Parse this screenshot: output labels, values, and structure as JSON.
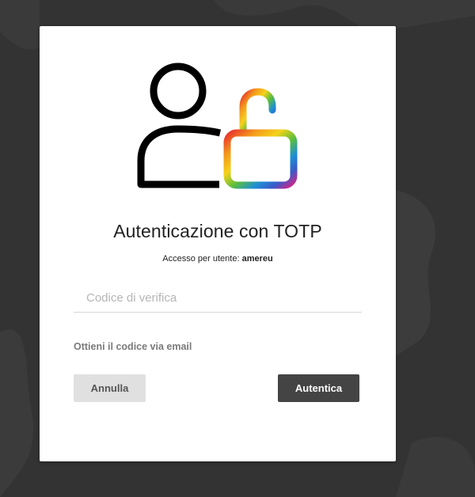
{
  "dialog": {
    "title": "Autenticazione con TOTP",
    "subtitle_prefix": "Accesso per utente:",
    "username": "amereu",
    "code_field": {
      "value": "",
      "placeholder": "Codice di verifica"
    },
    "email_link": "Ottieni il codice via email",
    "cancel_button": "Annulla",
    "auth_button": "Autentica"
  },
  "icons": {
    "logo": "user-unlock-icon"
  },
  "colors": {
    "background": "#333333",
    "card": "#ffffff",
    "primary_button": "#444444",
    "secondary_button": "#e0e0e0",
    "lock_gradient": [
      "#e8302c",
      "#f39a1b",
      "#f5d21a",
      "#5cbf3b",
      "#1e8fd6",
      "#3a5ac8",
      "#d2268a"
    ]
  }
}
